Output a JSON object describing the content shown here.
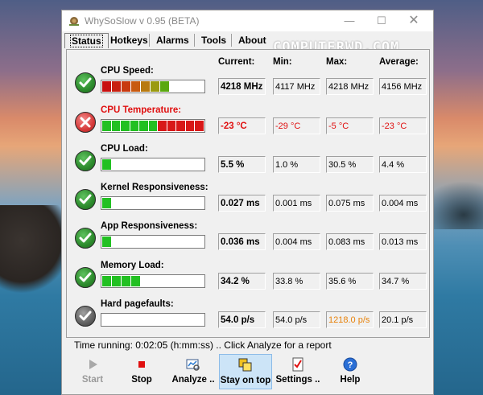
{
  "window": {
    "title": "WhySoSlow v 0.95  (BETA)",
    "min_glyph": "—",
    "max_glyph": "☐",
    "close_glyph": "✕"
  },
  "watermark": "COMPUTERWD.COM",
  "tabs": [
    {
      "label": "Status",
      "active": true
    },
    {
      "label": "Hotkeys",
      "active": false
    },
    {
      "label": "Alarms",
      "active": false
    },
    {
      "label": "Tools",
      "active": false
    },
    {
      "label": "About",
      "active": false
    }
  ],
  "headers": {
    "current": "Current:",
    "min": "Min:",
    "max": "Max:",
    "average": "Average:"
  },
  "metrics": [
    {
      "label": "CPU Speed:",
      "status": "ok",
      "current": "4218 MHz",
      "min": "4117 MHz",
      "max": "4218 MHz",
      "average": "4156 MHz",
      "bar_fraction": 0.62,
      "label_color": "#000000",
      "value_color": "#000000",
      "max_color": "#000000",
      "bar_style": "gradient"
    },
    {
      "label": "CPU Temperature:",
      "status": "bad",
      "current": "-23 °C",
      "min": "-29 °C",
      "max": "-5 °C",
      "average": "-23 °C",
      "bar_fraction": 1.0,
      "label_color": "#e01010",
      "value_color": "#e01010",
      "max_color": "#e01010",
      "bar_style": "green-red"
    },
    {
      "label": "CPU Load:",
      "status": "ok",
      "current": "5.5 %",
      "min": "1.0 %",
      "max": "30.5 %",
      "average": "4.4 %",
      "bar_fraction": 0.08,
      "label_color": "#000000",
      "value_color": "#000000",
      "max_color": "#000000",
      "bar_style": "green"
    },
    {
      "label": "Kernel Responsiveness:",
      "status": "ok",
      "current": "0.027 ms",
      "min": "0.001 ms",
      "max": "0.075 ms",
      "average": "0.004 ms",
      "bar_fraction": 0.08,
      "label_color": "#000000",
      "value_color": "#000000",
      "max_color": "#000000",
      "bar_style": "green"
    },
    {
      "label": "App Responsiveness:",
      "status": "ok",
      "current": "0.036 ms",
      "min": "0.004 ms",
      "max": "0.083 ms",
      "average": "0.013 ms",
      "bar_fraction": 0.08,
      "label_color": "#000000",
      "value_color": "#000000",
      "max_color": "#000000",
      "bar_style": "green"
    },
    {
      "label": "Memory Load:",
      "status": "ok",
      "current": "34.2 %",
      "min": "33.8 %",
      "max": "35.6 %",
      "average": "34.7 %",
      "bar_fraction": 0.33,
      "label_color": "#000000",
      "value_color": "#000000",
      "max_color": "#000000",
      "bar_style": "green"
    },
    {
      "label": "Hard pagefaults:",
      "status": "neutral",
      "current": "54.0 p/s",
      "min": "54.0 p/s",
      "max": "1218.0 p/s",
      "average": "20.1 p/s",
      "bar_fraction": 0.0,
      "label_color": "#000000",
      "value_color": "#000000",
      "max_color": "#e8820a",
      "bar_style": "green"
    }
  ],
  "status_text": "Time running: 0:02:05  (h:mm:ss) ..  Click Analyze for a report",
  "toolbar": [
    {
      "label": "Start",
      "icon": "play-icon",
      "enabled": false,
      "pressed": false
    },
    {
      "label": "Stop",
      "icon": "stop-icon",
      "enabled": true,
      "pressed": false
    },
    {
      "label": "Analyze ..",
      "icon": "analyze-icon",
      "enabled": true,
      "pressed": false
    },
    {
      "label": "Stay on top",
      "icon": "stay-on-top-icon",
      "enabled": true,
      "pressed": true
    },
    {
      "label": "Settings ..",
      "icon": "settings-icon",
      "enabled": true,
      "pressed": false
    },
    {
      "label": "Help",
      "icon": "help-icon",
      "enabled": true,
      "pressed": false
    }
  ]
}
